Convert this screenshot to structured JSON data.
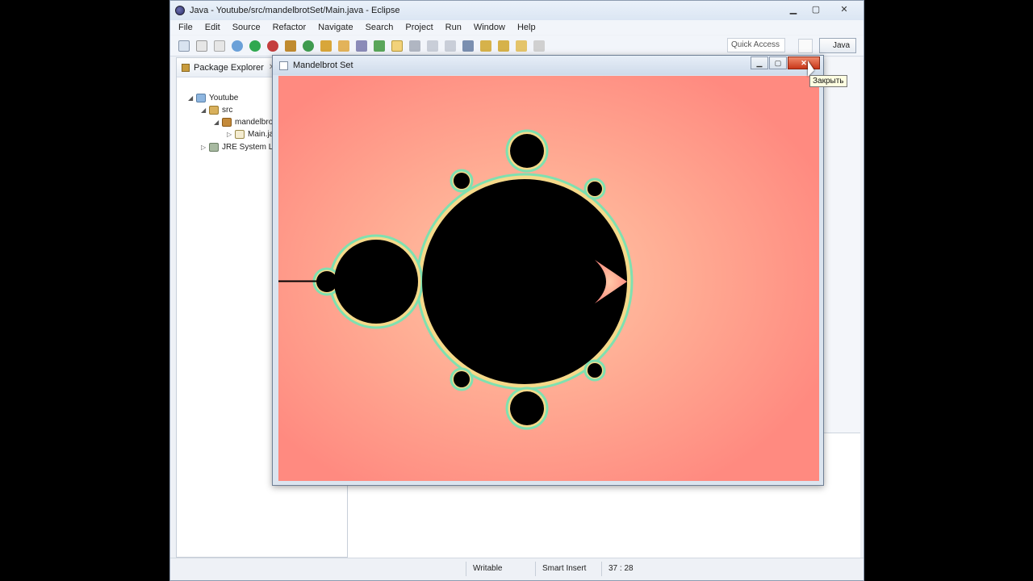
{
  "eclipse": {
    "title": "Java - Youtube/src/mandelbrotSet/Main.java - Eclipse",
    "controls": {
      "minimize": "▁",
      "maximize": "▢",
      "close": "✕"
    },
    "menu": [
      "File",
      "Edit",
      "Source",
      "Refactor",
      "Navigate",
      "Search",
      "Project",
      "Run",
      "Window",
      "Help"
    ],
    "quick_access": "Quick Access",
    "perspective": "Java"
  },
  "package_explorer": {
    "tab_label": "Package Explorer",
    "close_glyph": "✕",
    "tree": [
      {
        "label": "Youtube",
        "arrow": "◢"
      },
      {
        "label": "src",
        "arrow": "◢"
      },
      {
        "label": "mandelbrot",
        "arrow": "◢"
      },
      {
        "label": "Main.java",
        "arrow": "▷"
      },
      {
        "label": "JRE System Libr",
        "arrow": "▷"
      }
    ]
  },
  "status": {
    "writable": "Writable",
    "insert_mode": "Smart Insert",
    "position": "37 : 28"
  },
  "mandelbrot_window": {
    "title": "Mandelbrot Set",
    "controls": {
      "minimize": "▁",
      "maximize": "▢",
      "close": "✕"
    }
  },
  "tooltip": "Закрыть",
  "colors": {
    "background": "#ff8a80",
    "outer_glow": "#ffb9a3",
    "fringe": "#f6d98a",
    "edge": "#7fe0b0",
    "set": "#000000"
  }
}
